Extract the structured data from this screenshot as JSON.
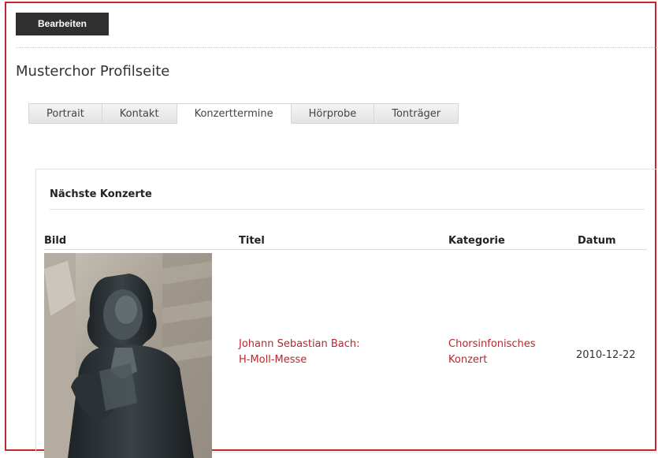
{
  "toolbar": {
    "edit_label": "Bearbeiten"
  },
  "page": {
    "title": "Musterchor Profilseite"
  },
  "tabs": [
    {
      "label": "Portrait",
      "active": false
    },
    {
      "label": "Kontakt",
      "active": false
    },
    {
      "label": "Konzerttermine",
      "active": true
    },
    {
      "label": "Hörprobe",
      "active": false
    },
    {
      "label": "Tonträger",
      "active": false
    }
  ],
  "concerts": {
    "heading": "Nächste Konzerte",
    "columns": [
      "Bild",
      "Titel",
      "Kategorie",
      "Datum"
    ],
    "rows": [
      {
        "image": "bach-statue-photo",
        "title_line1": "Johann Sebastian Bach:",
        "title_line2": "H-Moll-Messe",
        "category_line1": "Chorsinfonisches",
        "category_line2": "Konzert",
        "date": "2010-12-22"
      }
    ]
  },
  "colors": {
    "accent": "#b8272c",
    "frame_border": "#c0282d",
    "button_bg": "#2f2f2f"
  }
}
